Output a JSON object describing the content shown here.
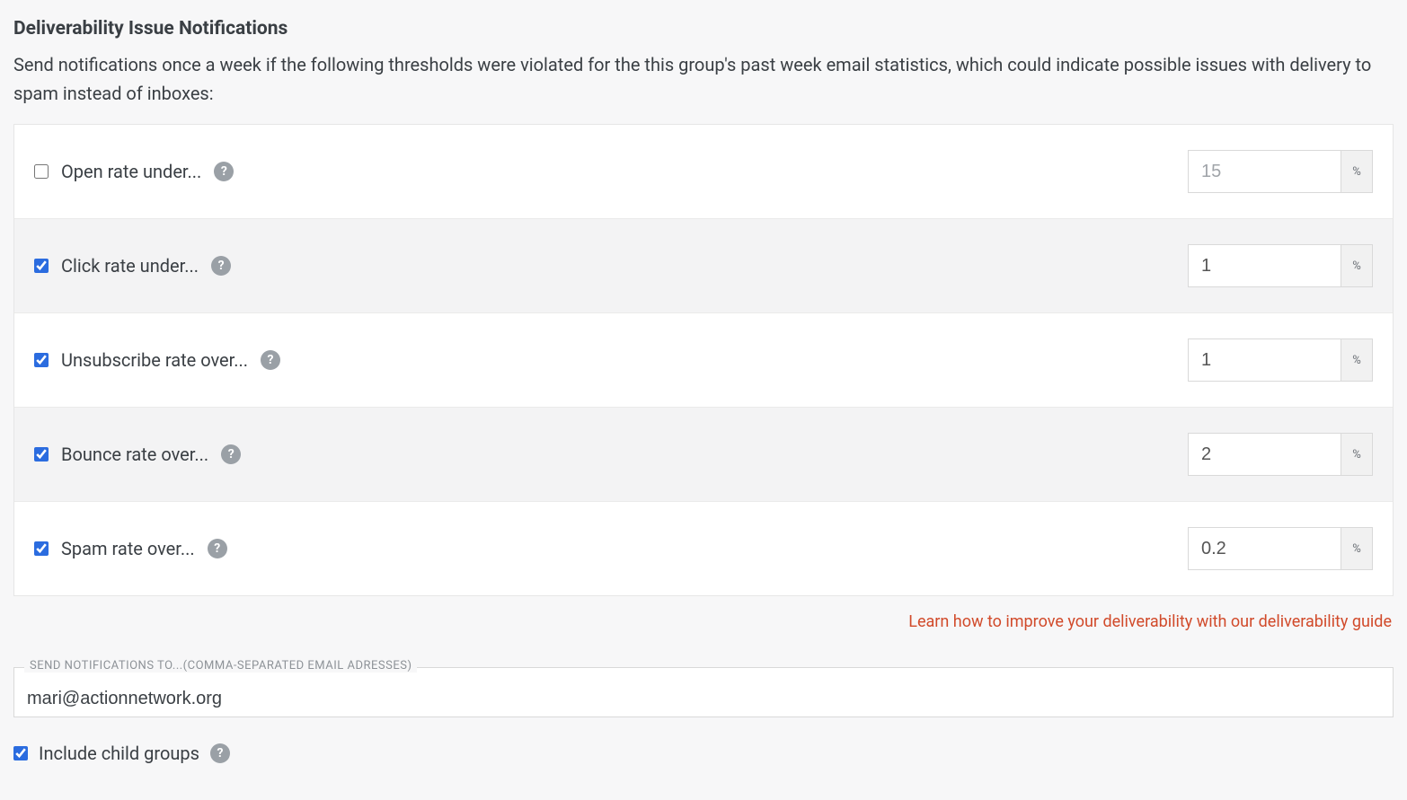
{
  "section": {
    "title": "Deliverability Issue Notifications",
    "description": "Send notifications once a week if the following thresholds were violated for the this group's past week email statistics, which could indicate possible issues with delivery to spam instead of inboxes:"
  },
  "thresholds": [
    {
      "label": "Open rate under...",
      "checked": false,
      "value": "15",
      "unit": "%"
    },
    {
      "label": "Click rate under...",
      "checked": true,
      "value": "1",
      "unit": "%"
    },
    {
      "label": "Unsubscribe rate over...",
      "checked": true,
      "value": "1",
      "unit": "%"
    },
    {
      "label": "Bounce rate over...",
      "checked": true,
      "value": "2",
      "unit": "%"
    },
    {
      "label": "Spam rate over...",
      "checked": true,
      "value": "0.2",
      "unit": "%"
    }
  ],
  "guide_link": "Learn how to improve your deliverability with our deliverability guide",
  "notifications": {
    "field_label": "SEND NOTIFICATIONS TO...(COMMA-SEPARATED EMAIL ADRESSES)",
    "value": "mari@actionnetwork.org"
  },
  "include_child_groups": {
    "label": "Include child groups",
    "checked": true
  },
  "help_glyph": "?"
}
